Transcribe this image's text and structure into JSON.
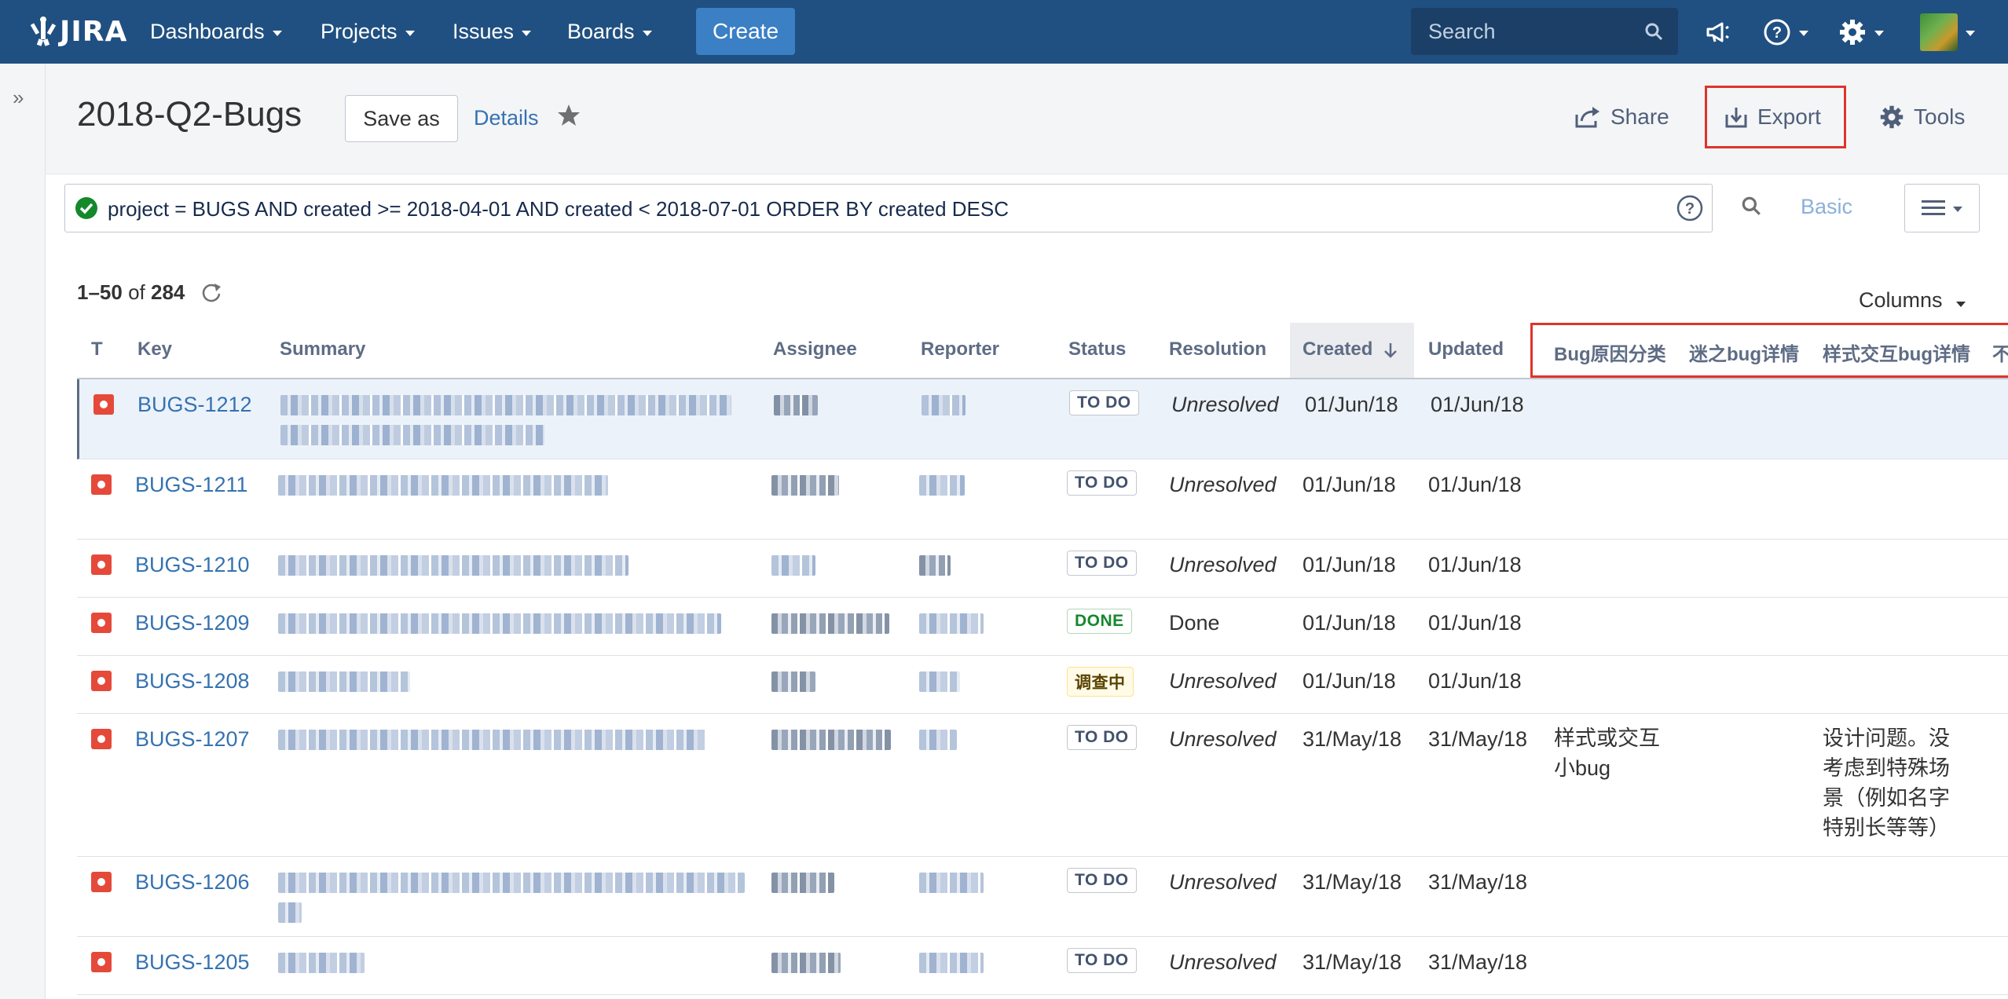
{
  "nav": {
    "logo_text": "JIRA",
    "items": [
      "Dashboards",
      "Projects",
      "Issues",
      "Boards"
    ],
    "create_label": "Create",
    "search_placeholder": "Search"
  },
  "filter": {
    "title": "2018-Q2-Bugs",
    "save_as_label": "Save as",
    "details_label": "Details",
    "share_label": "Share",
    "export_label": "Export",
    "tools_label": "Tools"
  },
  "jql": {
    "query": "project = BUGS AND created >= 2018-04-01 AND created < 2018-07-01 ORDER BY created DESC",
    "basic_label": "Basic"
  },
  "results": {
    "range": "1–50",
    "of_label": "of",
    "total": "284",
    "columns_label": "Columns"
  },
  "table": {
    "headers": {
      "type": "T",
      "key": "Key",
      "summary": "Summary",
      "assignee": "Assignee",
      "reporter": "Reporter",
      "status": "Status",
      "resolution": "Resolution",
      "created": "Created",
      "updated": "Updated",
      "cf1": "Bug原因分类",
      "cf2": "迷之bug详情",
      "cf3": "样式交互bug详情",
      "cf4": "不"
    },
    "rows": [
      {
        "key": "BUGS-1212",
        "status": "TO DO",
        "resolution": "Unresolved",
        "created": "01/Jun/18",
        "updated": "01/Jun/18",
        "cf1": "",
        "cf3": ""
      },
      {
        "key": "BUGS-1211",
        "status": "TO DO",
        "resolution": "Unresolved",
        "created": "01/Jun/18",
        "updated": "01/Jun/18",
        "cf1": "",
        "cf3": ""
      },
      {
        "key": "BUGS-1210",
        "status": "TO DO",
        "resolution": "Unresolved",
        "created": "01/Jun/18",
        "updated": "01/Jun/18",
        "cf1": "",
        "cf3": ""
      },
      {
        "key": "BUGS-1209",
        "status": "DONE",
        "resolution": "Done",
        "created": "01/Jun/18",
        "updated": "01/Jun/18",
        "cf1": "",
        "cf3": ""
      },
      {
        "key": "BUGS-1208",
        "status": "调查中",
        "resolution": "Unresolved",
        "created": "01/Jun/18",
        "updated": "01/Jun/18",
        "cf1": "",
        "cf3": ""
      },
      {
        "key": "BUGS-1207",
        "status": "TO DO",
        "resolution": "Unresolved",
        "created": "31/May/18",
        "updated": "31/May/18",
        "cf1": "样式或交互小bug",
        "cf3": "设计问题。没考虑到特殊场景（例如名字特别长等等）"
      },
      {
        "key": "BUGS-1206",
        "status": "TO DO",
        "resolution": "Unresolved",
        "created": "31/May/18",
        "updated": "31/May/18",
        "cf1": "",
        "cf3": ""
      },
      {
        "key": "BUGS-1205",
        "status": "TO DO",
        "resolution": "Unresolved",
        "created": "31/May/18",
        "updated": "31/May/18",
        "cf1": "",
        "cf3": ""
      }
    ]
  },
  "colors": {
    "nav_bg": "#205081",
    "create_bg": "#3b7fc4",
    "link": "#3572b0",
    "highlight_border": "#e0332b",
    "bug_icon": "#e5493a"
  }
}
